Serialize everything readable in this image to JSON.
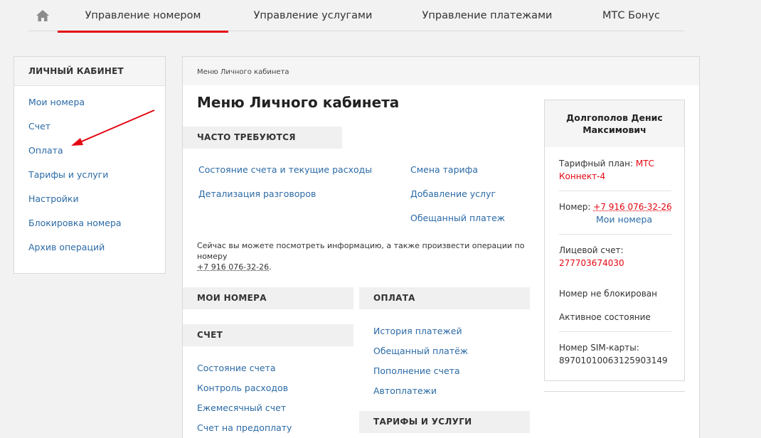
{
  "topnav": {
    "home_icon": "home-icon",
    "tabs": [
      {
        "label": "Управление номером",
        "active": true
      },
      {
        "label": "Управление услугами"
      },
      {
        "label": "Управление платежами"
      },
      {
        "label": "МТС Бонус"
      }
    ]
  },
  "sidebar": {
    "title": "ЛИЧНЫЙ КАБИНЕТ",
    "items": [
      {
        "label": "Мои номера"
      },
      {
        "label": "Счет"
      },
      {
        "label": "Оплата"
      },
      {
        "label": "Тарифы и услуги"
      },
      {
        "label": "Настройки"
      },
      {
        "label": "Блокировка номера"
      },
      {
        "label": "Архив операций"
      }
    ]
  },
  "main": {
    "breadcrumb": "Меню Личного кабинета",
    "title": "Меню Личного кабинета",
    "frequent": {
      "title": "ЧАСТО ТРЕБУЮТСЯ",
      "left": [
        "Состояние счета и текущие расходы",
        "Детализация разговоров"
      ],
      "right": [
        "Смена тарифа",
        "Добавление услуг",
        "Обещанный платеж"
      ]
    },
    "info_text": "Сейчас вы можете посмотреть информацию, а также произвести операции по номеру",
    "info_number": "+7 916 076-32-26",
    "info_end": ".",
    "my_numbers_title": "МОИ НОМЕРА",
    "account": {
      "title": "СЧЕТ",
      "links": [
        "Состояние счета",
        "Контроль расходов",
        "Ежемесячный счет",
        "Счет на предоплату"
      ]
    },
    "payment": {
      "title": "ОПЛАТА",
      "links": [
        "История платежей",
        "Обещанный платёж",
        "Пополнение счета",
        "Автоплатежи"
      ]
    },
    "tariffs_title": "ТАРИФЫ И УСЛУГИ"
  },
  "profile": {
    "name_line1": "Долгополов Денис",
    "name_line2": "Максимович",
    "tariff_label": "Тарифный план: ",
    "tariff_value_1": "МТС",
    "tariff_value_2": "Коннект-4",
    "number_label": "Номер: ",
    "number_value": "+7 916 076-32-26",
    "my_numbers_link": "Мои номера",
    "account_label": "Лицевой счет:",
    "account_value": "277703674030",
    "block_status": "Номер не блокирован",
    "state": "Активное состояние",
    "sim_label": "Номер SIM-карты:",
    "sim_value": "89701010063125903149"
  },
  "colors": {
    "accent_red": "#e30611",
    "link_blue": "#2b6aa6"
  }
}
